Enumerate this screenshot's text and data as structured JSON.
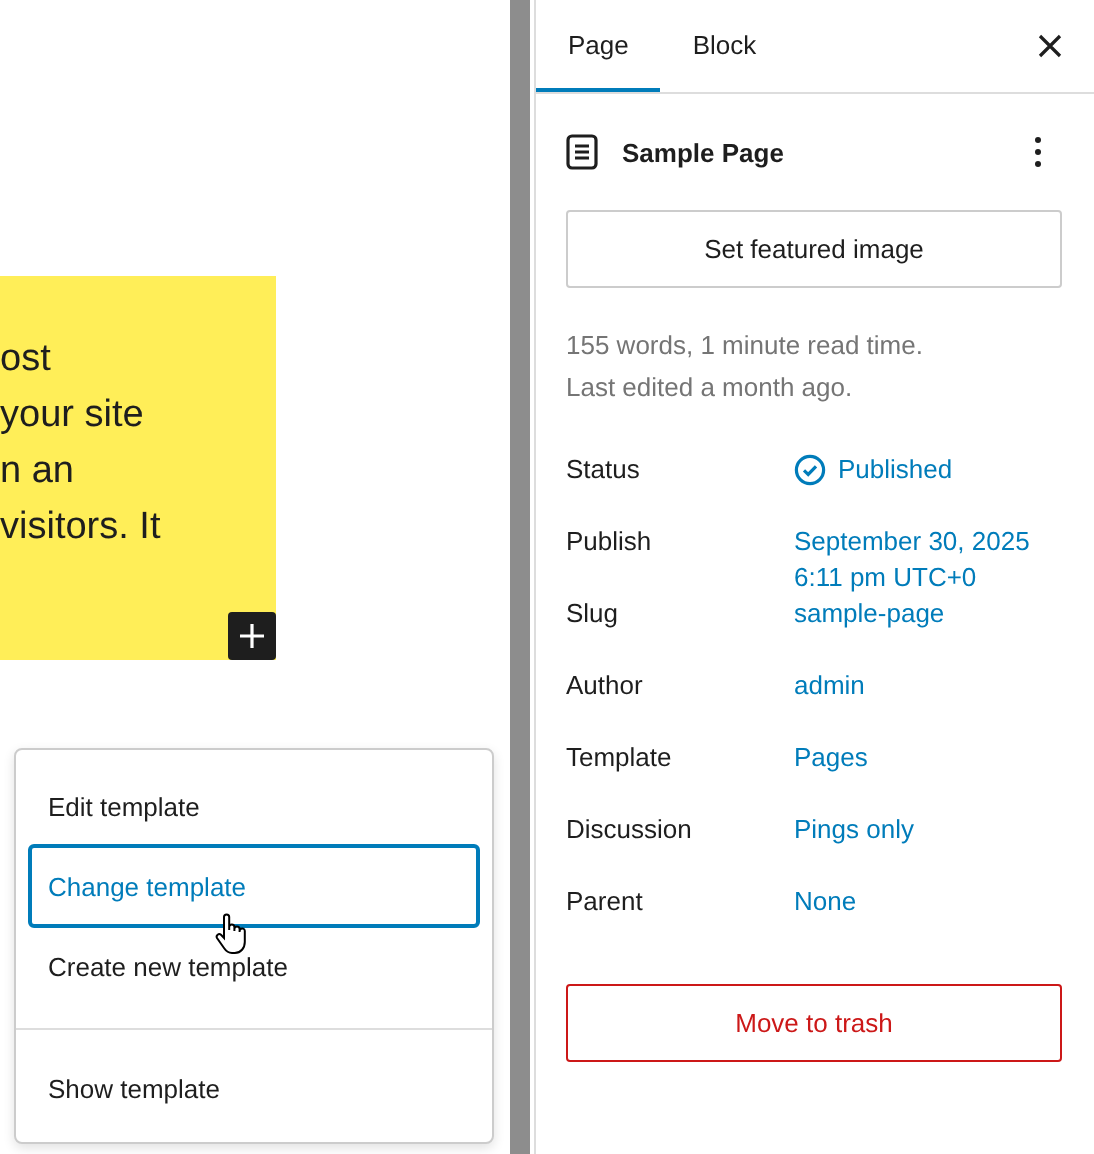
{
  "editor": {
    "cover_lines": [
      "ost",
      "your site",
      "n an",
      "visitors. It"
    ]
  },
  "template_menu": {
    "items": [
      {
        "label": "Edit template",
        "selected": false
      },
      {
        "label": "Change template",
        "selected": true
      },
      {
        "label": "Create new template",
        "selected": false
      }
    ],
    "footer_items": [
      {
        "label": "Show template",
        "selected": false
      }
    ]
  },
  "sidebar": {
    "tabs": [
      {
        "label": "Page",
        "selected": true
      },
      {
        "label": "Block",
        "selected": false
      }
    ],
    "document_title": "Sample Page",
    "featured_button": "Set featured image",
    "stats": [
      "155 words, 1 minute read time.",
      "Last edited a month ago."
    ],
    "fields": [
      {
        "label": "Status",
        "kind": "status",
        "value_lines": [
          "Published"
        ]
      },
      {
        "label": "Publish",
        "kind": "link",
        "value_lines": [
          "September 30, 2025",
          "6:11 pm UTC+0"
        ]
      },
      {
        "label": "Slug",
        "kind": "link",
        "value_lines": [
          "sample-page"
        ]
      },
      {
        "label": "Author",
        "kind": "link",
        "value_lines": [
          "admin"
        ]
      },
      {
        "label": "Template",
        "kind": "link",
        "value_lines": [
          "Pages"
        ]
      },
      {
        "label": "Discussion",
        "kind": "link",
        "value_lines": [
          "Pings only"
        ]
      },
      {
        "label": "Parent",
        "kind": "link",
        "value_lines": [
          "None"
        ]
      }
    ],
    "trash_button": "Move to trash"
  }
}
